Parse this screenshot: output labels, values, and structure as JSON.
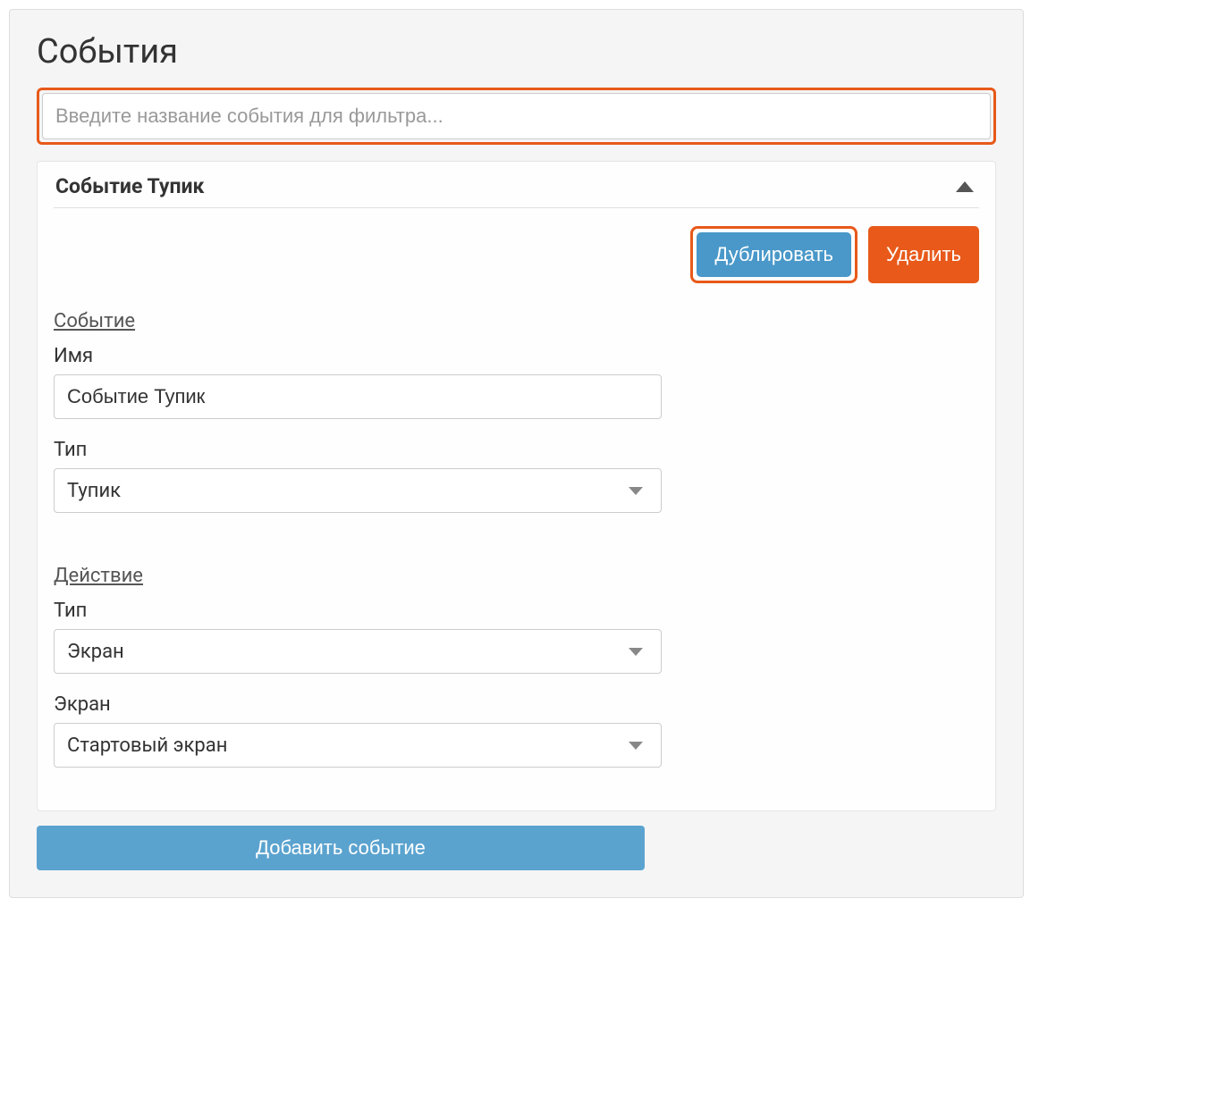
{
  "panel": {
    "title": "События"
  },
  "filter": {
    "placeholder": "Введите название события для фильтра..."
  },
  "event": {
    "header_title": "Событие Тупик",
    "buttons": {
      "duplicate": "Дублировать",
      "delete": "Удалить"
    },
    "section_event": {
      "label": "Событие",
      "name_label": "Имя",
      "name_value": "Событие Тупик",
      "type_label": "Тип",
      "type_value": "Тупик"
    },
    "section_action": {
      "label": "Действие",
      "type_label": "Тип",
      "type_value": "Экран",
      "screen_label": "Экран",
      "screen_value": "Стартовый экран"
    }
  },
  "add_button": "Добавить событие"
}
